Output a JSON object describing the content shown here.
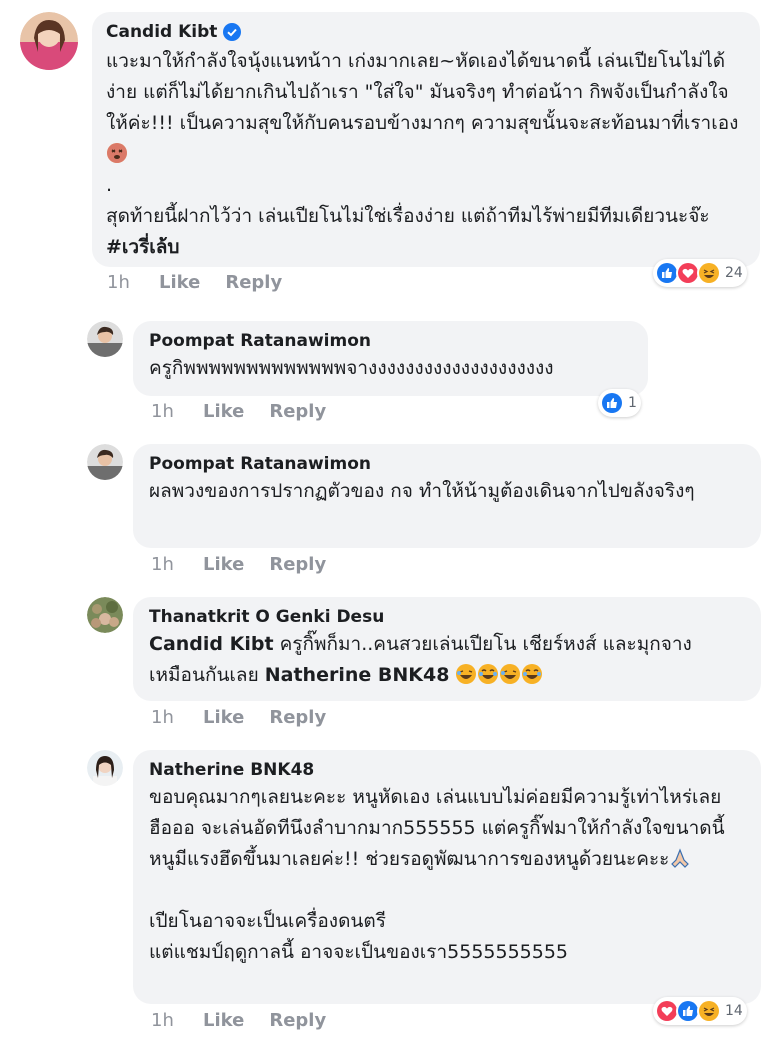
{
  "comments": [
    {
      "author": "Candid Kibt",
      "verified": true,
      "text_lines": "แวะมาให้กำลังใจนุ้งแนทน้าา เก่งมากเลย~หัดเองได้ขนาดนี้ เล่นเปียโนไม่ได้ง่าย แต่ก็ไม่ได้ยากเกินไปถ้าเรา \"ใส่ใจ\" มันจริงๆ ทำต่อน้าา กิพจังเป็นกำลังใจให้ค่ะ!!! เป็นความสุขให้กับคนรอบข้างมากๆ ความสุขนั้นจะสะท้อนมาที่เราเอง",
      "text_line2": ".",
      "text_line3": "สุดท้ายนี้ฝากไว้ว่า เล่นเปียโนไม่ใช่เรื่องง่าย แต่ถ้าทีมไร้พ่ายมีทีมเดียวนะจ๊ะ ",
      "hashtag": "#เวรี่เล้บ",
      "time": "1h",
      "like": "Like",
      "reply": "Reply",
      "reaction_count": "24"
    },
    {
      "author": "Poompat Ratanawimon",
      "text": "ครูกิพพพพพพพพพพพพพจางงงงงงงงงงงงงงงงงงงง",
      "time": "1h",
      "like": "Like",
      "reply": "Reply",
      "reaction_count": "1"
    },
    {
      "author": "Poompat Ratanawimon",
      "text": "ผลพวงของการปรากฏตัวของ กจ ทำให้น้ามูต้องเดินจากไปขลังจริงๆ",
      "time": "1h",
      "like": "Like",
      "reply": "Reply"
    },
    {
      "author": "Thanatkrit O Genki Desu",
      "mention1": "Candid Kibt",
      "text_a": " ครูกิ๊พก็มา..คนสวยเล่นเปียโน เชียร์หงส์ และมุกจางเหมือนกันเลย ",
      "mention2": "Natherine BNK48",
      "time": "1h",
      "like": "Like",
      "reply": "Reply"
    },
    {
      "author": "Natherine BNK48",
      "text_p1": "ขอบคุณมากๆเลยนะคะะ หนูหัดเอง เล่นแบบไม่ค่อยมีความรู้เท่าไหร่เลย ฮือออ จะเล่นอัดทีนึงลำบากมาก555555 แต่ครูกิ๊ฟมาให้กำลังใจขนาดนี้ หนูมีแรงฮึดขึ้นมาเลยค่ะ!! ช่วยรอดูพัฒนาการของหนูด้วยนะคะะ",
      "text_p2": "เปียโนอาจจะเป็นเครื่องดนตรี",
      "text_p3": "แต่แชมป์ฤดูกาลนี้ อาจจะเป็นของเรา5555555555",
      "time": "1h",
      "like": "Like",
      "reply": "Reply",
      "reaction_count": "14"
    }
  ],
  "colors": {
    "bubble": "#f2f3f5",
    "muted": "#90949c",
    "like_blue": "#1877f2",
    "love_red": "#f33e58",
    "haha_yellow": "#f7b125"
  }
}
